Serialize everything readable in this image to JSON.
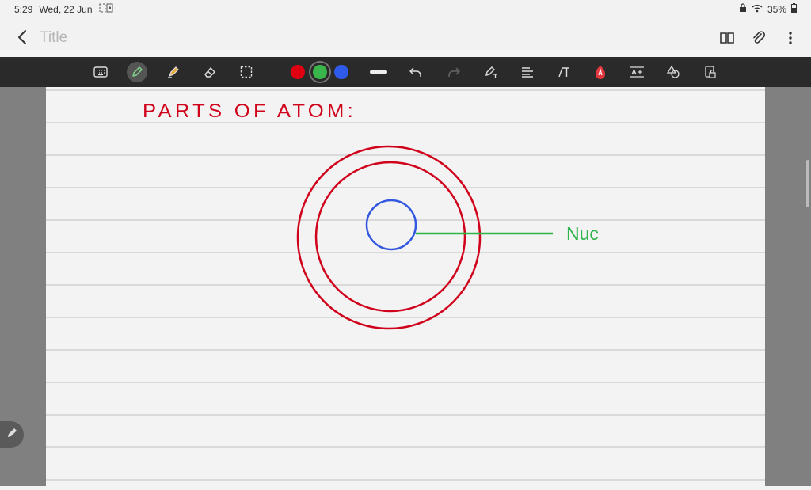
{
  "status_bar": {
    "time": "5:29",
    "date": "Wed, 22 Jun",
    "battery": "35%"
  },
  "title_bar": {
    "title": "Title"
  },
  "toolbar": {
    "tools": [
      "keyboard-icon",
      "pen-icon",
      "highlighter-icon",
      "eraser-icon",
      "lasso-select-icon"
    ],
    "active_tool": "pen-icon",
    "colors": [
      "#e00012",
      "#3ab54a",
      "#2f5bea"
    ],
    "selected_color": "#3ab54a"
  },
  "note": {
    "heading": "PARTS OF ATOM:",
    "label": "Nuc",
    "ink_colors": {
      "red": "#d0021b",
      "green": "#2fb34a",
      "blue": "#3257e0"
    }
  }
}
